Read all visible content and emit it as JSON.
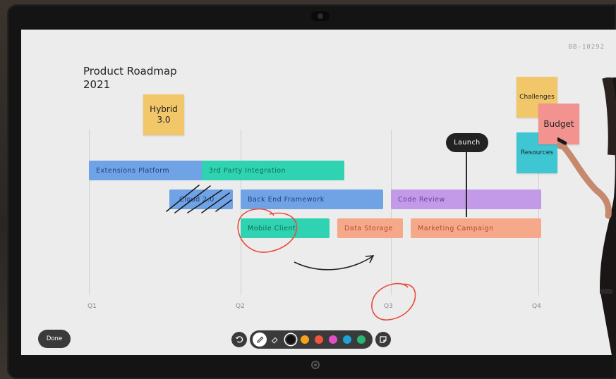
{
  "board": {
    "id": "BB-10292",
    "title_line1": "Product Roadmap",
    "title_line2": "2021"
  },
  "quarters": [
    "Q1",
    "Q2",
    "Q3",
    "Q4"
  ],
  "stickies": {
    "hybrid": "Hybrid 3.0",
    "challenges": "Challenges",
    "budget": "Budget",
    "resources": "Resources"
  },
  "bars": {
    "extensions_platform": "Extensions Platform",
    "third_party_integration": "3rd Party Integration",
    "cloud": "Cloud 2.0",
    "back_end_framework": "Back End Framework",
    "code_review": "Code Review",
    "mobile_client": "Mobile Client",
    "data_storage": "Data Storage",
    "marketing_campaign": "Marketing Campaign"
  },
  "milestone": {
    "label": "Launch"
  },
  "controls": {
    "done_label": "Done",
    "undo_icon": "undo-icon",
    "pen_icon": "pen-icon",
    "eraser_icon": "eraser-icon",
    "sticky_icon": "sticky-note-icon"
  },
  "palette": [
    "#111111",
    "#f5a31a",
    "#f0553f",
    "#e04fc8",
    "#1fa2d8",
    "#2bb673"
  ],
  "selected_color": "#111111",
  "colors": {
    "blue": "#6fa3e6",
    "teal": "#2fd3b1",
    "purple": "#c39ae8",
    "salmon": "#f5a98a",
    "yellow": "#f2c76a",
    "pink": "#f2938f",
    "cyan": "#3ec7d3",
    "ink_red": "#ea4b3c"
  }
}
